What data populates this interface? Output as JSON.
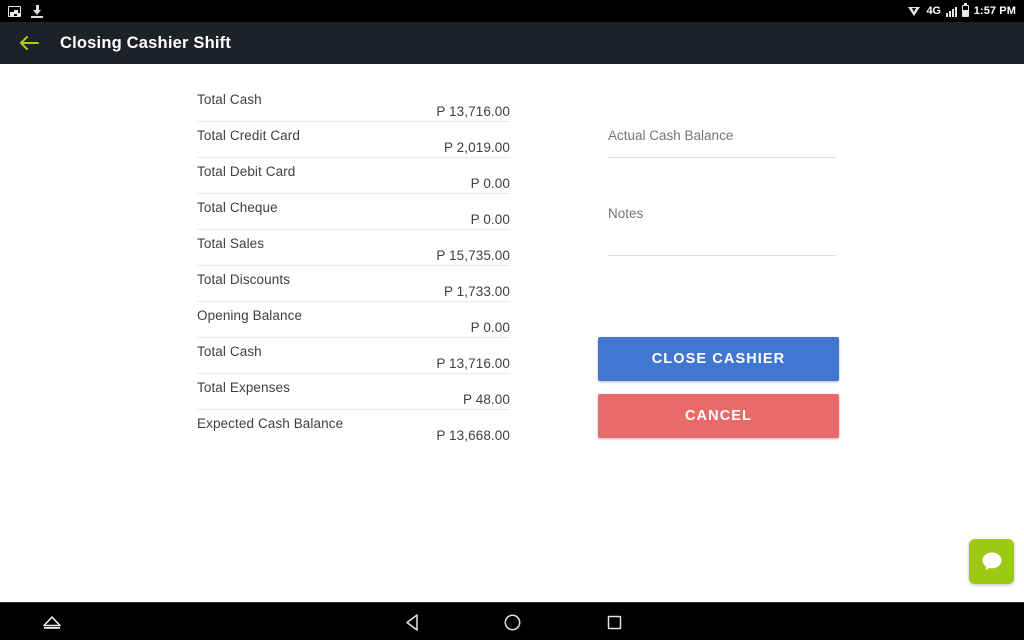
{
  "status_bar": {
    "left_icons": [
      "screenshot-icon",
      "download-icon"
    ],
    "network_label": "4G",
    "right_icons": [
      "wifi-icon",
      "signal-icon",
      "battery-icon"
    ],
    "time": "1:57 PM"
  },
  "app_bar": {
    "back_icon": "back-arrow-icon",
    "back_icon_color": "#a4d01a",
    "title": "Closing Cashier Shift",
    "background": "#1e2127"
  },
  "summary": {
    "rows": [
      {
        "label": "Total Cash",
        "value": "P 13,716.00"
      },
      {
        "label": "Total Credit Card",
        "value": "P 2,019.00"
      },
      {
        "label": "Total Debit Card",
        "value": "P 0.00"
      },
      {
        "label": "Total Cheque",
        "value": "P 0.00"
      },
      {
        "label": "Total Sales",
        "value": "P 15,735.00"
      },
      {
        "label": "Total Discounts",
        "value": "P 1,733.00"
      },
      {
        "label": "Opening Balance",
        "value": "P 0.00"
      },
      {
        "label": "Total Cash",
        "value": "P 13,716.00"
      },
      {
        "label": "Total Expenses",
        "value": "P 48.00"
      },
      {
        "label": "Expected Cash Balance",
        "value": "P 13,668.00"
      }
    ]
  },
  "form": {
    "actual_cash_balance": {
      "placeholder": "Actual Cash Balance",
      "value": ""
    },
    "notes": {
      "placeholder": "Notes",
      "value": ""
    },
    "close_button": {
      "label": "CLOSE CASHIER",
      "color": "#4177d1"
    },
    "cancel_button": {
      "label": "CANCEL",
      "color": "#ea6a6a"
    }
  },
  "chat_fab": {
    "icon": "chat-bubble-icon",
    "color": "#9dc813"
  },
  "nav_bar": {
    "items": [
      "eject-icon",
      "back-triangle-icon",
      "home-circle-icon",
      "recents-square-icon"
    ]
  }
}
